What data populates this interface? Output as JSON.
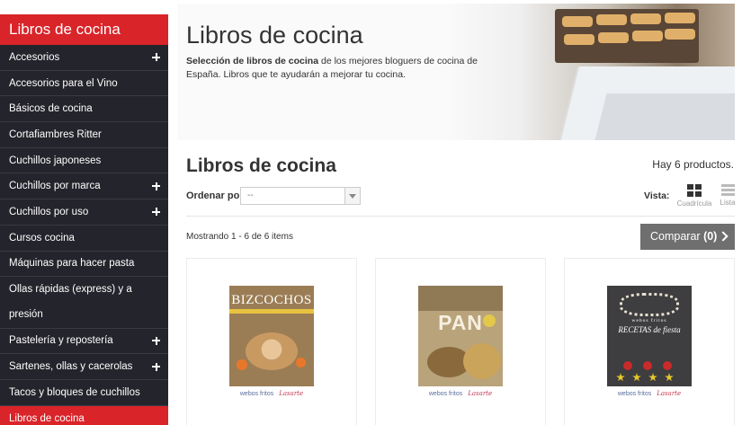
{
  "sidebar": {
    "header": "Libros de cocina",
    "items": [
      {
        "label": "Accesorios",
        "expandable": true
      },
      {
        "label": "Accesorios para el Vino",
        "expandable": false
      },
      {
        "label": "Básicos de cocina",
        "expandable": false
      },
      {
        "label": "Cortafiambres Ritter",
        "expandable": false
      },
      {
        "label": "Cuchillos japoneses",
        "expandable": false
      },
      {
        "label": "Cuchillos por marca",
        "expandable": true
      },
      {
        "label": "Cuchillos por uso",
        "expandable": true
      },
      {
        "label": "Cursos cocina",
        "expandable": false
      },
      {
        "label": "Máquinas para hacer pasta",
        "expandable": false
      },
      {
        "label": "Ollas rápidas (express) y a presión",
        "expandable": false
      },
      {
        "label": "Pastelería y repostería",
        "expandable": true
      },
      {
        "label": "Sartenes, ollas y cacerolas",
        "expandable": true
      },
      {
        "label": "Tacos y bloques de cuchillos",
        "expandable": false
      },
      {
        "label": "Libros de cocina",
        "expandable": false,
        "active": true
      }
    ]
  },
  "banner": {
    "title": "Libros de cocina",
    "desc_bold": "Selección de libros de cocina",
    "desc_rest": " de los mejores bloguers de cocina de España. Libros que te ayudarán a mejorar tu cocina."
  },
  "category": {
    "title": "Libros de cocina",
    "count": "Hay 6 productos."
  },
  "toolbar": {
    "sort_label": "Ordenar por",
    "sort_value": "--",
    "view_label": "Vista:",
    "view_grid": "Cuadrícula",
    "view_list": "Lista",
    "showing": "Mostrando 1 - 6 de 6 items",
    "compare_label": "Comparar",
    "compare_count": "(0)"
  },
  "products": [
    {
      "cover_title": "BIZCOCHOS",
      "publisher": "webos fritos",
      "imprint": "Lasarte"
    },
    {
      "cover_title": "PAN",
      "publisher": "webos fritos",
      "imprint": "Lasarte"
    },
    {
      "cover_title": "RECETAS de fiesta",
      "cover_pre": "webos fritos",
      "publisher": "webos fritos",
      "imprint": "Lasarte"
    }
  ],
  "colors": {
    "accent": "#d9242a",
    "sidebar_bg": "#24242c",
    "compare_bg": "#6f6f6f"
  }
}
